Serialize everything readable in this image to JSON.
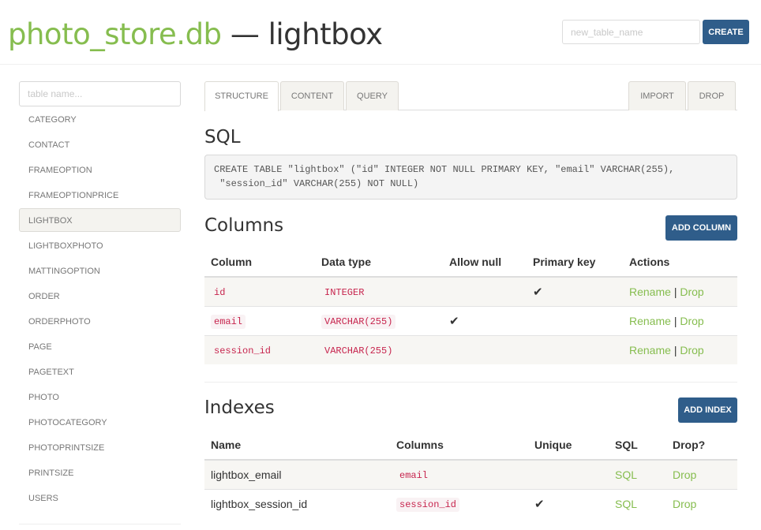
{
  "header": {
    "db_name": "photo_store.db",
    "separator": "—",
    "table_name": "lightbox",
    "new_table_placeholder": "new_table_name",
    "create_label": "CREATE"
  },
  "sidebar": {
    "search_placeholder": "table name...",
    "active": "LIGHTBOX",
    "items": [
      {
        "label": "CATEGORY"
      },
      {
        "label": "CONTACT"
      },
      {
        "label": "FRAMEOPTION"
      },
      {
        "label": "FRAMEOPTIONPRICE"
      },
      {
        "label": "LIGHTBOX"
      },
      {
        "label": "LIGHTBOXPHOTO"
      },
      {
        "label": "MATTINGOPTION"
      },
      {
        "label": "ORDER"
      },
      {
        "label": "ORDERPHOTO"
      },
      {
        "label": "PAGE"
      },
      {
        "label": "PAGETEXT"
      },
      {
        "label": "PHOTO"
      },
      {
        "label": "PHOTOCATEGORY"
      },
      {
        "label": "PHOTOPRINTSIZE"
      },
      {
        "label": "PRINTSIZE"
      },
      {
        "label": "USERS"
      }
    ]
  },
  "tabs": {
    "structure": "STRUCTURE",
    "content": "CONTENT",
    "query": "QUERY",
    "import": "IMPORT",
    "drop": "DROP",
    "active": "STRUCTURE"
  },
  "sql": {
    "heading": "SQL",
    "statement": "CREATE TABLE \"lightbox\" (\"id\" INTEGER NOT NULL PRIMARY KEY, \"email\" VARCHAR(255),\n \"session_id\" VARCHAR(255) NOT NULL)"
  },
  "columns": {
    "heading": "Columns",
    "add_label": "ADD COLUMN",
    "headers": [
      "Column",
      "Data type",
      "Allow null",
      "Primary key",
      "Actions"
    ],
    "rows": [
      {
        "name": "id",
        "type": "INTEGER",
        "allow_null": "",
        "primary_key": "✔",
        "rename": "Rename",
        "sep": "|",
        "drop": "Drop"
      },
      {
        "name": "email",
        "type": "VARCHAR(255)",
        "allow_null": "✔",
        "primary_key": "",
        "rename": "Rename",
        "sep": "|",
        "drop": "Drop"
      },
      {
        "name": "session_id",
        "type": "VARCHAR(255)",
        "allow_null": "",
        "primary_key": "",
        "rename": "Rename",
        "sep": "|",
        "drop": "Drop"
      }
    ]
  },
  "indexes": {
    "heading": "Indexes",
    "add_label": "ADD INDEX",
    "headers": [
      "Name",
      "Columns",
      "Unique",
      "SQL",
      "Drop?"
    ],
    "rows": [
      {
        "name": "lightbox_email",
        "columns": "email",
        "unique": "",
        "sql": "SQL",
        "drop": "Drop"
      },
      {
        "name": "lightbox_session_id",
        "columns": "session_id",
        "unique": "✔",
        "sql": "SQL",
        "drop": "Drop"
      }
    ]
  },
  "colors": {
    "accent_green": "#86bd4f",
    "button_blue": "#2f5d8a",
    "code_pink": "#c7254e"
  }
}
